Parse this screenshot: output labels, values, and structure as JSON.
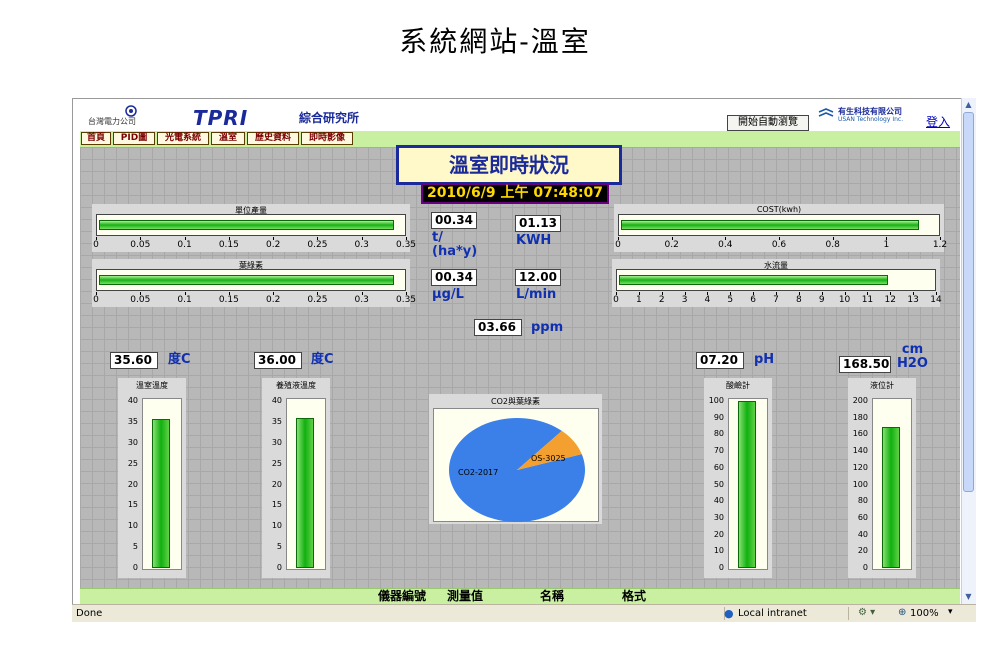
{
  "slide_title": "系統網站-溫室",
  "header": {
    "org_chinese": "台灣電力公司",
    "tpri_logo": "TPRI",
    "org_name": "綜合研究所",
    "auto_browse_label": "開始自動瀏覽",
    "usan_name": "有生科技有限公司",
    "usan_name_en": "USAN Technology Inc.",
    "login_label": "登入"
  },
  "nav": {
    "items": [
      "首頁",
      "PID圖",
      "光電系統",
      "溫室",
      "歷史資料",
      "即時影像"
    ]
  },
  "main": {
    "title": "溫室即時狀況",
    "datetime": "2010/6/9 上午 07:48:07"
  },
  "gauges": {
    "unit_yield": {
      "label": "單位產量",
      "value_fraction": 0.972,
      "ticks": [
        "0",
        "0.05",
        "0.1",
        "0.15",
        "0.2",
        "0.25",
        "0.3",
        "0.35"
      ]
    },
    "chlorophyll": {
      "label": "葉綠素",
      "value_fraction": 0.972,
      "ticks": [
        "0",
        "0.05",
        "0.1",
        "0.15",
        "0.2",
        "0.25",
        "0.3",
        "0.35"
      ]
    },
    "cost": {
      "label": "COST(kwh)",
      "value_fraction": 0.942,
      "ticks": [
        "0",
        "0.2",
        "0.4",
        "0.6",
        "0.8",
        "1",
        "1.2"
      ]
    },
    "water_flow": {
      "label": "水流量",
      "value_fraction": 0.857,
      "ticks": [
        "0",
        "1",
        "2",
        "3",
        "4",
        "5",
        "6",
        "7",
        "8",
        "9",
        "10",
        "11",
        "12",
        "13",
        "14"
      ]
    }
  },
  "readouts": {
    "yield_value": "00.34",
    "yield_unit": "t/\n(ha*y)",
    "kwh_value": "01.13",
    "kwh_unit": "KWH",
    "chl_value": "00.34",
    "chl_unit": "μg/L",
    "flow_value": "12.00",
    "flow_unit": "L/min",
    "co2_value": "03.66",
    "co2_unit": "ppm",
    "temp_value": "35.60",
    "temp_unit": "度C",
    "liquid_temp_value": "36.00",
    "liquid_temp_unit": "度C",
    "ph_value": "07.20",
    "ph_unit": "pH",
    "level_value": "168.50",
    "level_unit": "cm\nH2O"
  },
  "vgauges": {
    "greenhouse_temp": {
      "label": "溫室溫度",
      "value": 35.6,
      "max": 40,
      "ticks": [
        "40",
        "35",
        "30",
        "25",
        "20",
        "15",
        "10",
        "5",
        "0"
      ]
    },
    "liquid_temp": {
      "label": "養殖液溫度",
      "value": 36.0,
      "max": 40,
      "ticks": [
        "40",
        "35",
        "30",
        "25",
        "20",
        "15",
        "10",
        "5",
        "0"
      ]
    },
    "ph_meter": {
      "label": "酸鹼計",
      "value": 100,
      "max": 100,
      "ticks": [
        "100",
        "90",
        "80",
        "70",
        "60",
        "50",
        "40",
        "30",
        "20",
        "10",
        "0"
      ]
    },
    "level_meter": {
      "label": "液位計",
      "value": 168.5,
      "max": 200,
      "ticks": [
        "200",
        "180",
        "160",
        "140",
        "120",
        "100",
        "80",
        "60",
        "40",
        "20",
        "0"
      ]
    }
  },
  "chart_data": {
    "type": "pie",
    "title": "CO2與葉綠素",
    "slices": [
      {
        "label": "CO2-2017",
        "value": 2017,
        "color": "#3a80e8"
      },
      {
        "label": "OS-3025",
        "value": 190,
        "color": "#f4a030"
      }
    ]
  },
  "footer": {
    "col1": "儀器編號",
    "col2": "測量值",
    "col3": "名稱",
    "col4": "格式"
  },
  "status": {
    "left": "Done",
    "zone": "Local intranet",
    "zoom": "100%"
  }
}
